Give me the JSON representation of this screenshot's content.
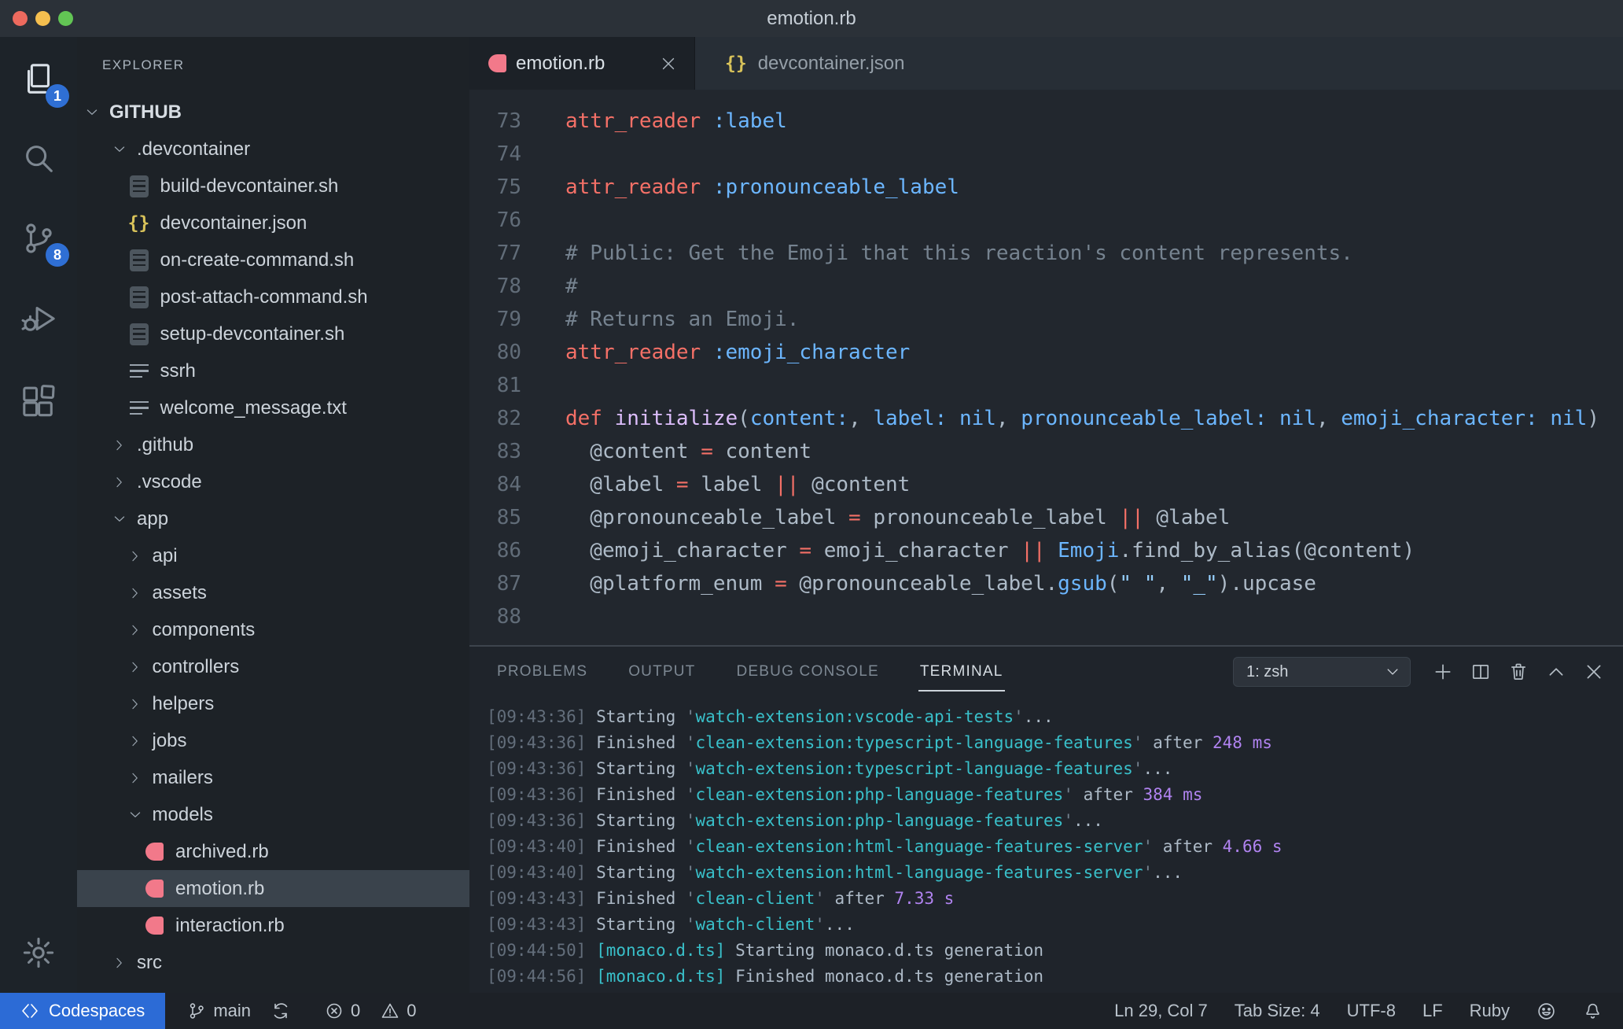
{
  "titlebar": {
    "title": "emotion.rb"
  },
  "activity_bar": {
    "items": [
      {
        "name": "explorer",
        "icon": "files-icon",
        "badge": "1",
        "active": true
      },
      {
        "name": "search",
        "icon": "search-icon"
      },
      {
        "name": "source-control",
        "icon": "source-control-icon",
        "badge": "8"
      },
      {
        "name": "run-debug",
        "icon": "run-debug-icon"
      },
      {
        "name": "extensions",
        "icon": "extensions-icon"
      }
    ],
    "settings": {
      "name": "settings",
      "icon": "gear-icon"
    }
  },
  "sidebar": {
    "header": "EXPLORER",
    "section": {
      "label": "GITHUB",
      "expanded": true
    },
    "tree": [
      {
        "label": ".devcontainer",
        "type": "folder",
        "level": 1,
        "expanded": true
      },
      {
        "label": "build-devcontainer.sh",
        "type": "file",
        "level": 2,
        "icon": "shell"
      },
      {
        "label": "devcontainer.json",
        "type": "file",
        "level": 2,
        "icon": "json"
      },
      {
        "label": "on-create-command.sh",
        "type": "file",
        "level": 2,
        "icon": "shell"
      },
      {
        "label": "post-attach-command.sh",
        "type": "file",
        "level": 2,
        "icon": "shell"
      },
      {
        "label": "setup-devcontainer.sh",
        "type": "file",
        "level": 2,
        "icon": "shell"
      },
      {
        "label": "ssrh",
        "type": "file",
        "level": 2,
        "icon": "list"
      },
      {
        "label": "welcome_message.txt",
        "type": "file",
        "level": 2,
        "icon": "list"
      },
      {
        "label": ".github",
        "type": "folder",
        "level": 1,
        "expanded": false
      },
      {
        "label": ".vscode",
        "type": "folder",
        "level": 1,
        "expanded": false
      },
      {
        "label": "app",
        "type": "folder",
        "level": 1,
        "expanded": true
      },
      {
        "label": "api",
        "type": "folder",
        "level": 2,
        "expanded": false
      },
      {
        "label": "assets",
        "type": "folder",
        "level": 2,
        "expanded": false
      },
      {
        "label": "components",
        "type": "folder",
        "level": 2,
        "expanded": false
      },
      {
        "label": "controllers",
        "type": "folder",
        "level": 2,
        "expanded": false
      },
      {
        "label": "helpers",
        "type": "folder",
        "level": 2,
        "expanded": false
      },
      {
        "label": "jobs",
        "type": "folder",
        "level": 2,
        "expanded": false
      },
      {
        "label": "mailers",
        "type": "folder",
        "level": 2,
        "expanded": false
      },
      {
        "label": "models",
        "type": "folder",
        "level": 2,
        "expanded": true
      },
      {
        "label": "archived.rb",
        "type": "file",
        "level": 3,
        "icon": "ruby"
      },
      {
        "label": "emotion.rb",
        "type": "file",
        "level": 3,
        "icon": "ruby",
        "selected": true
      },
      {
        "label": "interaction.rb",
        "type": "file",
        "level": 3,
        "icon": "ruby"
      },
      {
        "label": "src",
        "type": "folder",
        "level": 1,
        "expanded": false
      }
    ]
  },
  "editor": {
    "tabs": [
      {
        "label": "emotion.rb",
        "icon": "ruby",
        "active": true,
        "closable": true
      },
      {
        "label": "devcontainer.json",
        "icon": "json",
        "active": false,
        "closable": false
      }
    ],
    "lines": [
      {
        "num": "73",
        "segs": [
          [
            "attr_reader",
            "kw"
          ],
          [
            " ",
            "pl"
          ],
          [
            ":label",
            "cn"
          ]
        ]
      },
      {
        "num": "74",
        "segs": []
      },
      {
        "num": "75",
        "segs": [
          [
            "attr_reader",
            "kw"
          ],
          [
            " ",
            "pl"
          ],
          [
            ":pronounceable_label",
            "cn"
          ]
        ]
      },
      {
        "num": "76",
        "segs": []
      },
      {
        "num": "77",
        "segs": [
          [
            "# Public: Get the Emoji that this reaction's content represents.",
            "cm"
          ]
        ]
      },
      {
        "num": "78",
        "segs": [
          [
            "#",
            "cm"
          ]
        ]
      },
      {
        "num": "79",
        "segs": [
          [
            "# Returns an Emoji.",
            "cm"
          ]
        ]
      },
      {
        "num": "80",
        "segs": [
          [
            "attr_reader",
            "kw"
          ],
          [
            " ",
            "pl"
          ],
          [
            ":emoji_character",
            "cn"
          ]
        ]
      },
      {
        "num": "81",
        "segs": []
      },
      {
        "num": "82",
        "segs": [
          [
            "def",
            "kw"
          ],
          [
            " ",
            "pl"
          ],
          [
            "initialize",
            "fn"
          ],
          [
            "(",
            "pl"
          ],
          [
            "content:",
            "cn"
          ],
          [
            ", ",
            "pl"
          ],
          [
            "label:",
            "cn"
          ],
          [
            " ",
            "pl"
          ],
          [
            "nil",
            "cn"
          ],
          [
            ", ",
            "pl"
          ],
          [
            "pronounceable_label:",
            "cn"
          ],
          [
            " ",
            "pl"
          ],
          [
            "nil",
            "cn"
          ],
          [
            ", ",
            "pl"
          ],
          [
            "emoji_character:",
            "cn"
          ],
          [
            " ",
            "pl"
          ],
          [
            "nil",
            "cn"
          ],
          [
            ")",
            "pl"
          ]
        ]
      },
      {
        "num": "83",
        "segs": [
          [
            "  @content ",
            "pl"
          ],
          [
            "=",
            "kw"
          ],
          [
            " content",
            "pl"
          ]
        ]
      },
      {
        "num": "84",
        "segs": [
          [
            "  @label ",
            "pl"
          ],
          [
            "=",
            "kw"
          ],
          [
            " label ",
            "pl"
          ],
          [
            "||",
            "kw"
          ],
          [
            " @content",
            "pl"
          ]
        ]
      },
      {
        "num": "85",
        "segs": [
          [
            "  @pronounceable_label ",
            "pl"
          ],
          [
            "=",
            "kw"
          ],
          [
            " pronounceable_label ",
            "pl"
          ],
          [
            "||",
            "kw"
          ],
          [
            " @label",
            "pl"
          ]
        ]
      },
      {
        "num": "86",
        "segs": [
          [
            "  @emoji_character ",
            "pl"
          ],
          [
            "=",
            "kw"
          ],
          [
            " emoji_character ",
            "pl"
          ],
          [
            "||",
            "kw"
          ],
          [
            " ",
            "pl"
          ],
          [
            "Emoji",
            "cn"
          ],
          [
            ".find_by_alias(@content)",
            "pl"
          ]
        ]
      },
      {
        "num": "87",
        "segs": [
          [
            "  @platform_enum ",
            "pl"
          ],
          [
            "=",
            "kw"
          ],
          [
            " @pronounceable_label.",
            "pl"
          ],
          [
            "gsub",
            "cn"
          ],
          [
            "(",
            "pl"
          ],
          [
            "\" \"",
            "st"
          ],
          [
            ", ",
            "pl"
          ],
          [
            "\"_\"",
            "st"
          ],
          [
            ").upcase",
            "pl"
          ]
        ]
      },
      {
        "num": "88",
        "segs": []
      }
    ]
  },
  "panel": {
    "tabs": [
      {
        "label": "PROBLEMS"
      },
      {
        "label": "OUTPUT"
      },
      {
        "label": "DEBUG CONSOLE"
      },
      {
        "label": "TERMINAL",
        "active": true
      }
    ],
    "terminal_select": "1: zsh",
    "controls": [
      {
        "name": "new-terminal",
        "icon": "plus-icon"
      },
      {
        "name": "split-terminal",
        "icon": "split-icon"
      },
      {
        "name": "kill-terminal",
        "icon": "trash-icon"
      },
      {
        "name": "maximize-panel",
        "icon": "chevron-up-icon"
      },
      {
        "name": "close-panel",
        "icon": "close-icon"
      }
    ],
    "terminal_lines": [
      [
        [
          "[09:43:36]",
          "ts"
        ],
        [
          " Starting ",
          "pl"
        ],
        [
          "'",
          "qt"
        ],
        [
          "watch-extension:vscode-api-tests",
          "nm"
        ],
        [
          "'",
          "qt"
        ],
        [
          "...",
          "pl"
        ]
      ],
      [
        [
          "[09:43:36]",
          "ts"
        ],
        [
          " Finished ",
          "pl"
        ],
        [
          "'",
          "qt"
        ],
        [
          "clean-extension:typescript-language-features",
          "nm"
        ],
        [
          "'",
          "qt"
        ],
        [
          " after ",
          "pl"
        ],
        [
          "248 ms",
          "dur"
        ]
      ],
      [
        [
          "[09:43:36]",
          "ts"
        ],
        [
          " Starting ",
          "pl"
        ],
        [
          "'",
          "qt"
        ],
        [
          "watch-extension:typescript-language-features",
          "nm"
        ],
        [
          "'",
          "qt"
        ],
        [
          "...",
          "pl"
        ]
      ],
      [
        [
          "[09:43:36]",
          "ts"
        ],
        [
          " Finished ",
          "pl"
        ],
        [
          "'",
          "qt"
        ],
        [
          "clean-extension:php-language-features",
          "nm"
        ],
        [
          "'",
          "qt"
        ],
        [
          " after ",
          "pl"
        ],
        [
          "384 ms",
          "dur"
        ]
      ],
      [
        [
          "[09:43:36]",
          "ts"
        ],
        [
          " Starting ",
          "pl"
        ],
        [
          "'",
          "qt"
        ],
        [
          "watch-extension:php-language-features",
          "nm"
        ],
        [
          "'",
          "qt"
        ],
        [
          "...",
          "pl"
        ]
      ],
      [
        [
          "[09:43:40]",
          "ts"
        ],
        [
          " Finished ",
          "pl"
        ],
        [
          "'",
          "qt"
        ],
        [
          "clean-extension:html-language-features-server",
          "nm"
        ],
        [
          "'",
          "qt"
        ],
        [
          " after ",
          "pl"
        ],
        [
          "4.66 s",
          "dur"
        ]
      ],
      [
        [
          "[09:43:40]",
          "ts"
        ],
        [
          " Starting ",
          "pl"
        ],
        [
          "'",
          "qt"
        ],
        [
          "watch-extension:html-language-features-server",
          "nm"
        ],
        [
          "'",
          "qt"
        ],
        [
          "...",
          "pl"
        ]
      ],
      [
        [
          "[09:43:43]",
          "ts"
        ],
        [
          " Finished ",
          "pl"
        ],
        [
          "'",
          "qt"
        ],
        [
          "clean-client",
          "nm"
        ],
        [
          "'",
          "qt"
        ],
        [
          " after ",
          "pl"
        ],
        [
          "7.33 s",
          "dur"
        ]
      ],
      [
        [
          "[09:43:43]",
          "ts"
        ],
        [
          " Starting ",
          "pl"
        ],
        [
          "'",
          "qt"
        ],
        [
          "watch-client",
          "nm"
        ],
        [
          "'",
          "qt"
        ],
        [
          "...",
          "pl"
        ]
      ],
      [
        [
          "[09:44:50]",
          "ts"
        ],
        [
          " ",
          "pl"
        ],
        [
          "[monaco.d.ts]",
          "nm"
        ],
        [
          " Starting monaco.d.ts generation",
          "pl"
        ]
      ],
      [
        [
          "[09:44:56]",
          "ts"
        ],
        [
          " ",
          "pl"
        ],
        [
          "[monaco.d.ts]",
          "nm"
        ],
        [
          " Finished monaco.d.ts generation",
          "pl"
        ]
      ]
    ]
  },
  "status_bar": {
    "codespaces_label": "Codespaces",
    "branch": "main",
    "errors": "0",
    "warnings": "0",
    "right_items": [
      {
        "name": "cursor-position",
        "label": "Ln 29, Col 7"
      },
      {
        "name": "tab-size",
        "label": "Tab Size: 4"
      },
      {
        "name": "encoding",
        "label": "UTF-8"
      },
      {
        "name": "eol",
        "label": "LF"
      },
      {
        "name": "language-mode",
        "label": "Ruby"
      }
    ]
  },
  "colors": {
    "accent_blue": "#2f6fd4",
    "codespaces_blue": "#2c6bd6",
    "ruby_pink": "#f2798a",
    "json_yellow": "#d9c35a",
    "code_keyword": "#f47067",
    "code_function": "#dcbdfb",
    "code_constant": "#6cb6ff",
    "code_string": "#96d0ff",
    "code_comment": "#768390",
    "terminal_teal": "#39c0ca",
    "terminal_purple": "#b083f0",
    "editor_bg": "#22272e",
    "sidebar_bg": "#1d2227",
    "panel_bg": "#1f242b",
    "titlebar_bg": "#2b3138"
  }
}
